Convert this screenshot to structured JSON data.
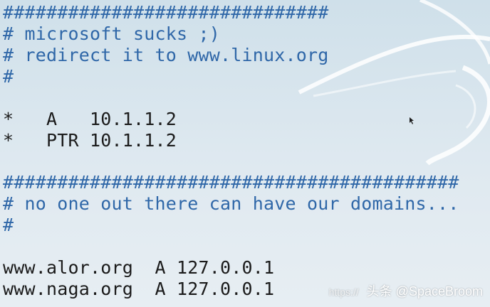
{
  "editor": {
    "lines": [
      {
        "text": "##############################",
        "kind": "comment"
      },
      {
        "text": "# microsoft sucks ;)",
        "kind": "comment"
      },
      {
        "text": "# redirect it to www.linux.org",
        "kind": "comment"
      },
      {
        "text": "#",
        "kind": "comment"
      },
      {
        "text": "",
        "kind": "plain"
      },
      {
        "text": "*   A   10.1.1.2",
        "kind": "plain"
      },
      {
        "text": "*   PTR 10.1.1.2",
        "kind": "plain"
      },
      {
        "text": "",
        "kind": "plain"
      },
      {
        "text": "##########################################",
        "kind": "comment"
      },
      {
        "text": "# no one out there can have our domains...",
        "kind": "comment"
      },
      {
        "text": "#",
        "kind": "comment"
      },
      {
        "text": "",
        "kind": "plain"
      },
      {
        "text": "www.alor.org  A 127.0.0.1",
        "kind": "plain"
      },
      {
        "text": "www.naga.org  A 127.0.0.1",
        "kind": "plain"
      }
    ]
  },
  "watermark": {
    "url_text": "https://",
    "label": "头条 @SpaceBroom"
  },
  "colors": {
    "comment": "#2f67a8",
    "plain": "#1b1b1b",
    "background_top": "#cfe0ea",
    "background_bottom": "#e7eef3"
  }
}
